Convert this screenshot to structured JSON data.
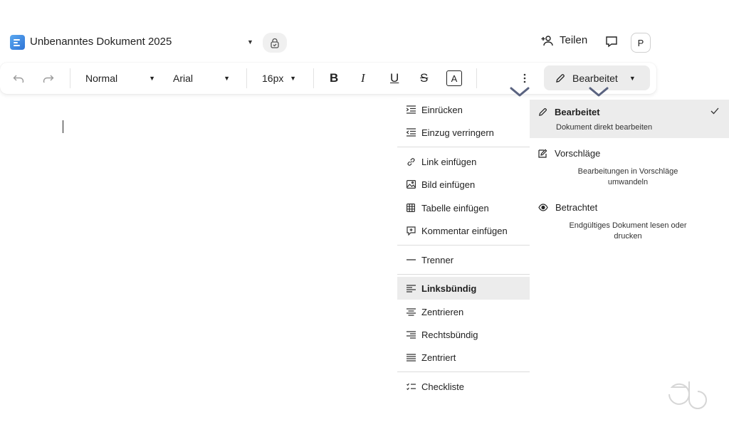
{
  "header": {
    "doc_title": "Unbenanntes Dokument 2025",
    "share_label": "Teilen",
    "avatar_initial": "P"
  },
  "toolbar": {
    "style_value": "Normal",
    "font_value": "Arial",
    "size_value": "16px",
    "bold": "B",
    "italic": "I",
    "underline": "U",
    "strike": "S",
    "color": "A",
    "mode_label": "Bearbeitet"
  },
  "menu": {
    "items": [
      {
        "label": "Einrücken",
        "icon": "indent-icon"
      },
      {
        "label": "Einzug verringern",
        "icon": "outdent-icon"
      },
      {
        "label": "Link einfügen",
        "icon": "link-icon"
      },
      {
        "label": "Bild einfügen",
        "icon": "image-icon"
      },
      {
        "label": "Tabelle einfügen",
        "icon": "table-icon"
      },
      {
        "label": "Kommentar einfügen",
        "icon": "comment-add-icon"
      },
      {
        "label": "Trenner",
        "icon": "divider-icon"
      },
      {
        "label": "Linksbündig",
        "icon": "align-left-icon",
        "active": true
      },
      {
        "label": "Zentrieren",
        "icon": "align-center-icon"
      },
      {
        "label": "Rechtsbündig",
        "icon": "align-right-icon"
      },
      {
        "label": "Zentriert",
        "icon": "align-justify-icon"
      },
      {
        "label": "Checkliste",
        "icon": "checklist-icon"
      }
    ]
  },
  "modes": {
    "items": [
      {
        "title": "Bearbeitet",
        "description": "Dokument direkt bearbeiten",
        "selected": true,
        "icon": "pencil-icon"
      },
      {
        "title": "Vorschläge",
        "description_lines": [
          "Bearbeitungen in Vorschläge",
          "umwandeln"
        ],
        "icon": "suggest-icon"
      },
      {
        "title": "Betrachtet",
        "description_lines": [
          "Endgültiges Dokument lesen oder",
          "drucken"
        ],
        "icon": "eye-icon"
      }
    ]
  },
  "colors": {
    "selected_bg": "#ececec",
    "chevron_marker": "#5a6380",
    "doc_icon": "#3b82e0"
  }
}
